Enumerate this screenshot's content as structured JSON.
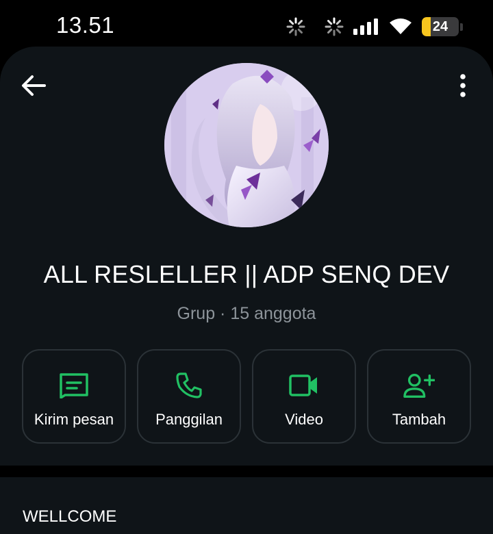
{
  "status_bar": {
    "time": "13.51",
    "icons": [
      "loading-icon",
      "loading-icon",
      "signal-icon",
      "wifi-icon",
      "battery-icon"
    ],
    "battery_level": "24",
    "battery_fraction": 0.24,
    "battery_color": "#f7c51e"
  },
  "header": {
    "back_icon": "arrow-left-icon",
    "more_icon": "more-vertical-icon",
    "title": "ALL RESLELLER || ADP SENQ DEV",
    "subtitle": "Grup · 15 anggota"
  },
  "actions": [
    {
      "label": "Kirim pesan",
      "icon": "message-icon"
    },
    {
      "label": "Panggilan",
      "icon": "phone-icon"
    },
    {
      "label": "Video",
      "icon": "video-icon"
    },
    {
      "label": "Tambah",
      "icon": "add-person-icon"
    }
  ],
  "description": {
    "text": "WELLCOME"
  },
  "colors": {
    "background": "#000000",
    "card": "#0f1418",
    "accent": "#21c063",
    "muted_text": "#8d949a",
    "button_border": "#2b3237"
  }
}
